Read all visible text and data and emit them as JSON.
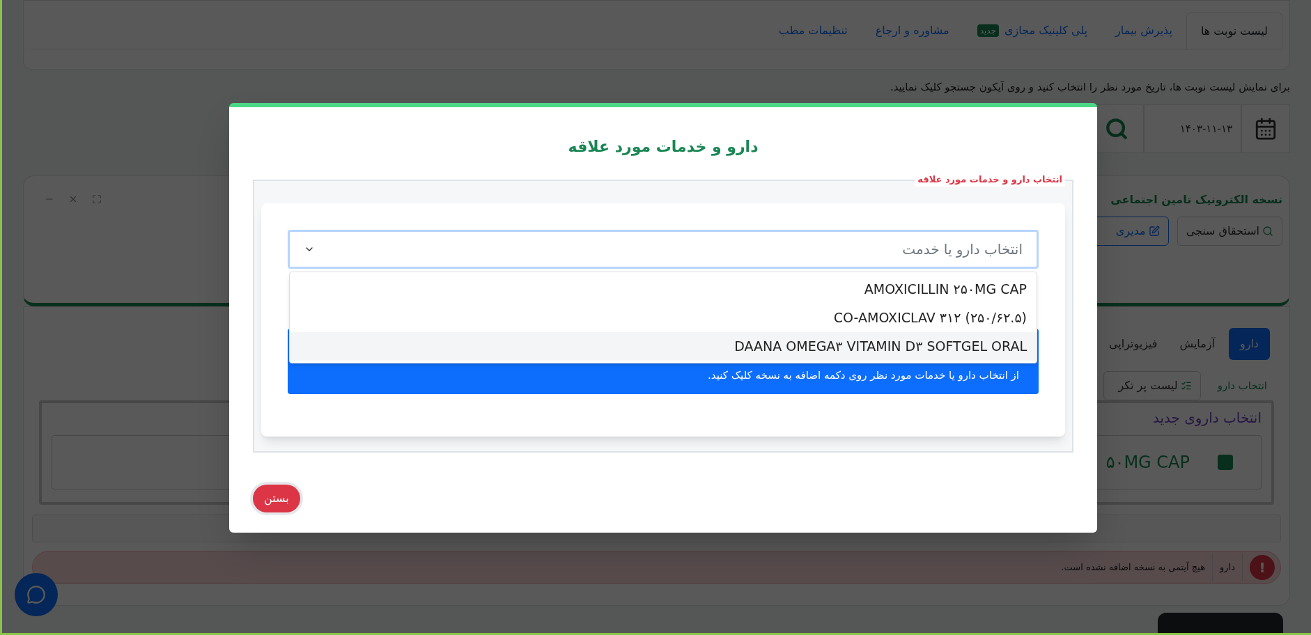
{
  "top_tabs": [
    {
      "label": "لیست نوبت ها",
      "selected": true
    },
    {
      "label": "پذیرش بیمار",
      "selected": false
    },
    {
      "label": "پلی کلینیک مجازی",
      "selected": false,
      "badge": "جدید"
    },
    {
      "label": "مشاوره و ارجاع",
      "selected": false
    },
    {
      "label": "تنظیمات مطب",
      "selected": false
    }
  ],
  "instruction": "برای نمایش لیست نوبت ها، تاریخ مورد نظر را انتخاب کنید و روی آیکون جستجو کلیک نمایید.",
  "date": "۱۴۰۳-۱۱-۱۳",
  "prescription_card": {
    "title": "نسخه الکترونیک تامین اجتماعی",
    "buttons": [
      {
        "kind": "search",
        "label": "استحقاق سنجی"
      },
      {
        "kind": "edit",
        "label": "مدیری"
      }
    ]
  },
  "section_tabs": [
    {
      "label": "دارو",
      "selected": true
    },
    {
      "label": "آزمایش",
      "selected": false
    },
    {
      "label": "فیزیوتراپی",
      "selected": false
    }
  ],
  "drug_fieldset": {
    "legend": "انتخاب دارو",
    "list_button": "لیست پر تکر",
    "new_drug_title": "انتخاب داروی جدید",
    "item": "۵۰MG CAP"
  },
  "alert": {
    "icon": "!",
    "category": "دارو",
    "message": "هیچ آیتمی به نسخه اضافه نشده است."
  },
  "modal": {
    "title": "دارو و خدمات مورد علاقه",
    "legend": "انتخاب دارو و خدمات مورد علاقه",
    "select": {
      "placeholder": "انتخاب دارو یا خدمت",
      "expanded": true
    },
    "options": [
      {
        "label": "AMOXICILLIN ۲۵۰MG CAP",
        "selected": false
      },
      {
        "label": "CO-AMOXICLAV ۳۱۲ (۲۵۰/۶۲.۵)",
        "selected": false
      },
      {
        "label": "DAANA OMEGA۳ VITAMIN D۳ SOFTGEL ORAL",
        "selected": true
      }
    ],
    "info": "از انتخاب دارو یا خدمات مورد نظر روی دکمه اضافه به نسخه کلیک کنید.",
    "close_button": "بستن"
  }
}
